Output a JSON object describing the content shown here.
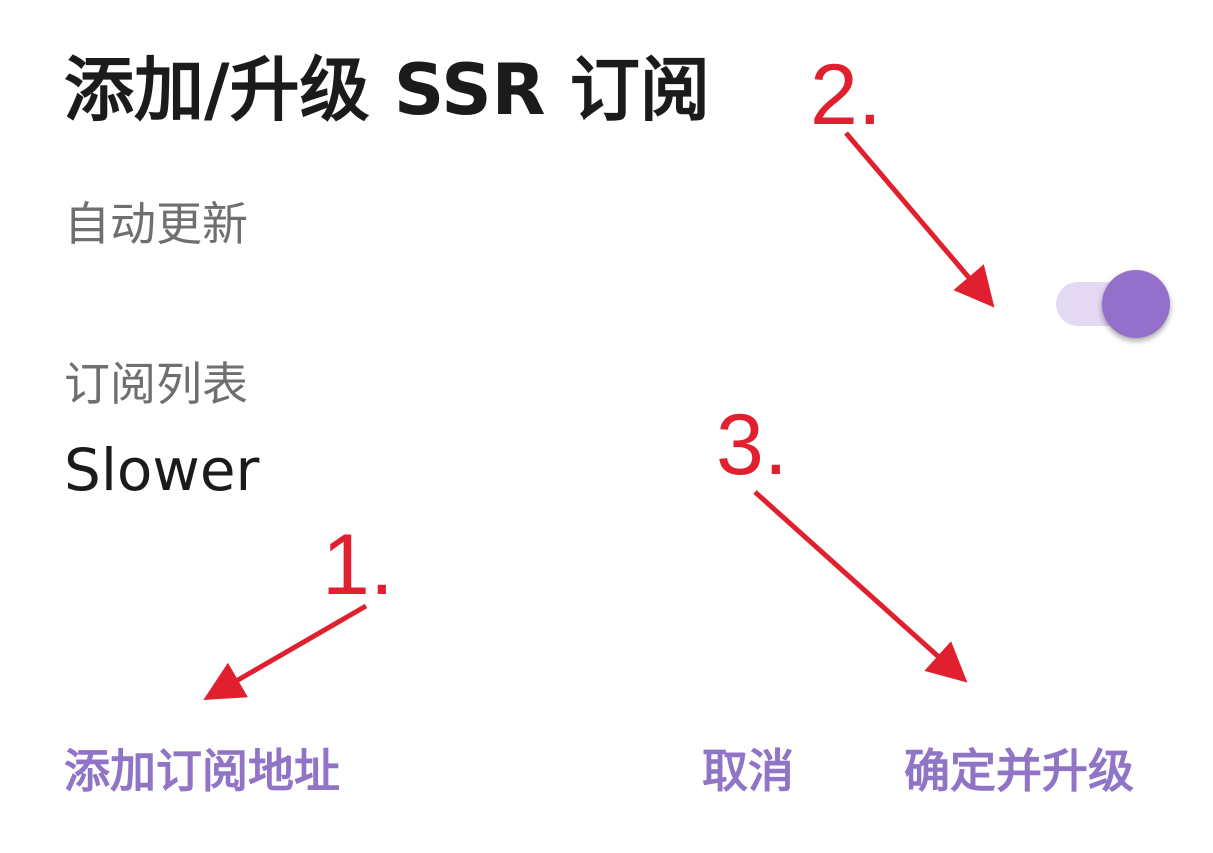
{
  "dialog": {
    "title": "添加/升级 SSR 订阅",
    "auto_update_label": "自动更新",
    "auto_update_enabled": true,
    "subscription_list_label": "订阅列表",
    "subscription_list_value": "Slower"
  },
  "buttons": {
    "add_url": "添加订阅地址",
    "cancel": "取消",
    "confirm_upgrade": "确定并升级"
  },
  "annotations": {
    "step1": "1.",
    "step2": "2.",
    "step3": "3."
  },
  "colors": {
    "accent": "#9074c6",
    "switch_thumb": "#9370cc",
    "switch_track": "#e3d9f2",
    "annotation_red": "#e0202e"
  }
}
